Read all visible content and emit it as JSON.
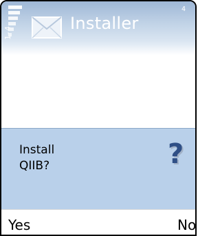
{
  "titlebar": {
    "title": "Installer",
    "app_icon": "envelope-icon",
    "signal_label": "1-4",
    "right_indicator": "4"
  },
  "dialog": {
    "line1": "Install",
    "line2": "QIIB?",
    "icon": "question-mark-icon"
  },
  "softkeys": {
    "left": "Yes",
    "right": "No"
  },
  "colors": {
    "titlebar_top": "#9eb7d6",
    "query_background": "#b9d0ea",
    "question_icon_color": "#2f4f86"
  }
}
